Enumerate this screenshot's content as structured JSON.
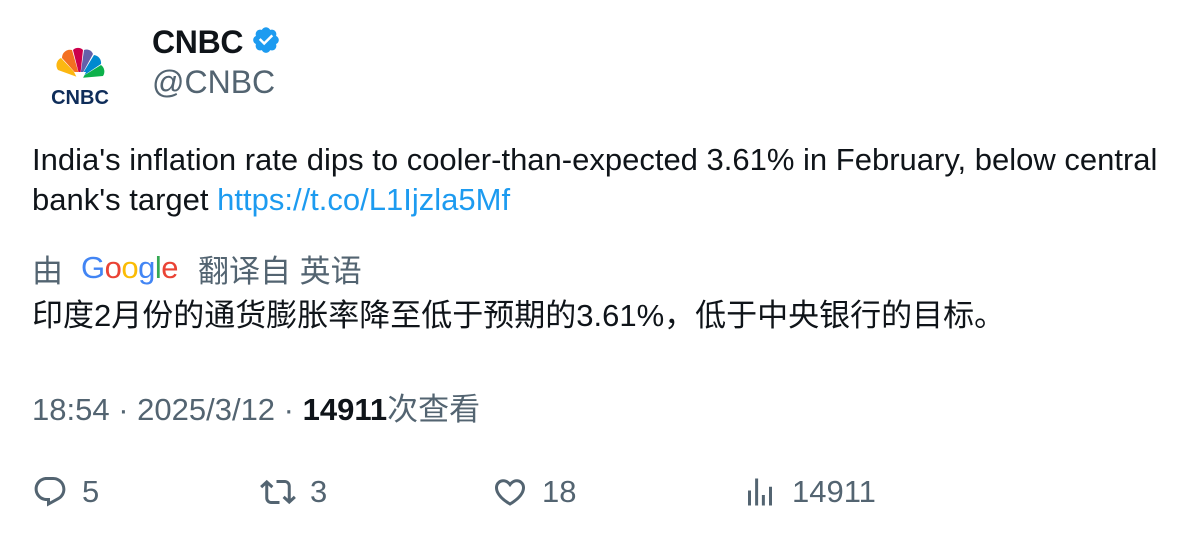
{
  "author": {
    "display_name": "CNBC",
    "handle": "@CNBC",
    "verified": true,
    "verified_color": "#1d9bf0"
  },
  "tweet": {
    "text": "India's inflation rate dips to cooler-than-expected 3.61% in February, below central bank's target ",
    "link": "https://t.co/L1Ijzla5Mf"
  },
  "translation": {
    "by_label": "由",
    "google_letters": [
      "G",
      "o",
      "o",
      "g",
      "l",
      "e"
    ],
    "from_label": "翻译自 英语",
    "translated_text": "印度2月份的通货膨胀率降至低于预期的3.61%，低于中央银行的目标。"
  },
  "meta": {
    "time": "18:54",
    "separator": " · ",
    "date": "2025/3/12",
    "views_count": "14911",
    "views_label": "次查看"
  },
  "actions": {
    "replies": "5",
    "retweets": "3",
    "likes": "18",
    "views": "14911"
  },
  "icons": {
    "reply": "reply-icon",
    "retweet": "retweet-icon",
    "like": "heart-icon",
    "views": "bar-chart-icon",
    "verified": "verified-badge-icon"
  }
}
